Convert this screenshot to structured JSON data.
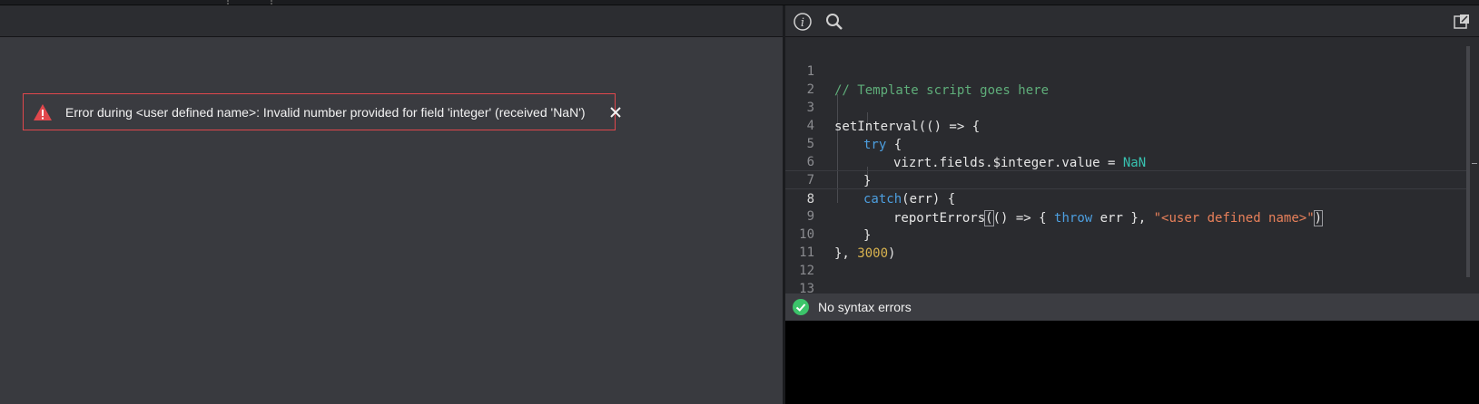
{
  "left_panel": {
    "error": {
      "message": "Error during <user defined name>: Invalid number provided for field 'integer' (received 'NaN')",
      "icon": "warning-icon",
      "close_icon": "close-icon",
      "color": "#e0474c"
    }
  },
  "right_panel": {
    "toolbar": {
      "info_icon": "info-icon",
      "search_icon": "search-icon",
      "popout_icon": "popout-icon"
    },
    "editor": {
      "line_numbers": [
        "1",
        "2",
        "3",
        "4",
        "5",
        "6",
        "7",
        "8",
        "9",
        "10",
        "11",
        "12",
        "13"
      ],
      "active_line": 8,
      "lines": {
        "l1_comment": "// Template script goes here",
        "l3_a": "setInterval(() => {",
        "l4_kw": "try",
        "l4_b": " {",
        "l5_a": "vizrt.fields.$integer.value = ",
        "l5_nan": "NaN",
        "l6_a": "}",
        "l7_kw": "catch",
        "l7_b": "(err) {",
        "l8_a": "reportErrors",
        "l8_paren": "(",
        "l8_b": "() => { ",
        "l8_kw": "throw",
        "l8_c": " err }, ",
        "l8_str": "\"<user defined name>\"",
        "l8_close": ")",
        "l9_a": "}",
        "l10_a": "}, ",
        "l10_num": "3000",
        "l10_b": ")"
      }
    },
    "status": {
      "text": "No syntax errors",
      "icon": "check-circle-icon",
      "color": "#3cc46a"
    }
  }
}
